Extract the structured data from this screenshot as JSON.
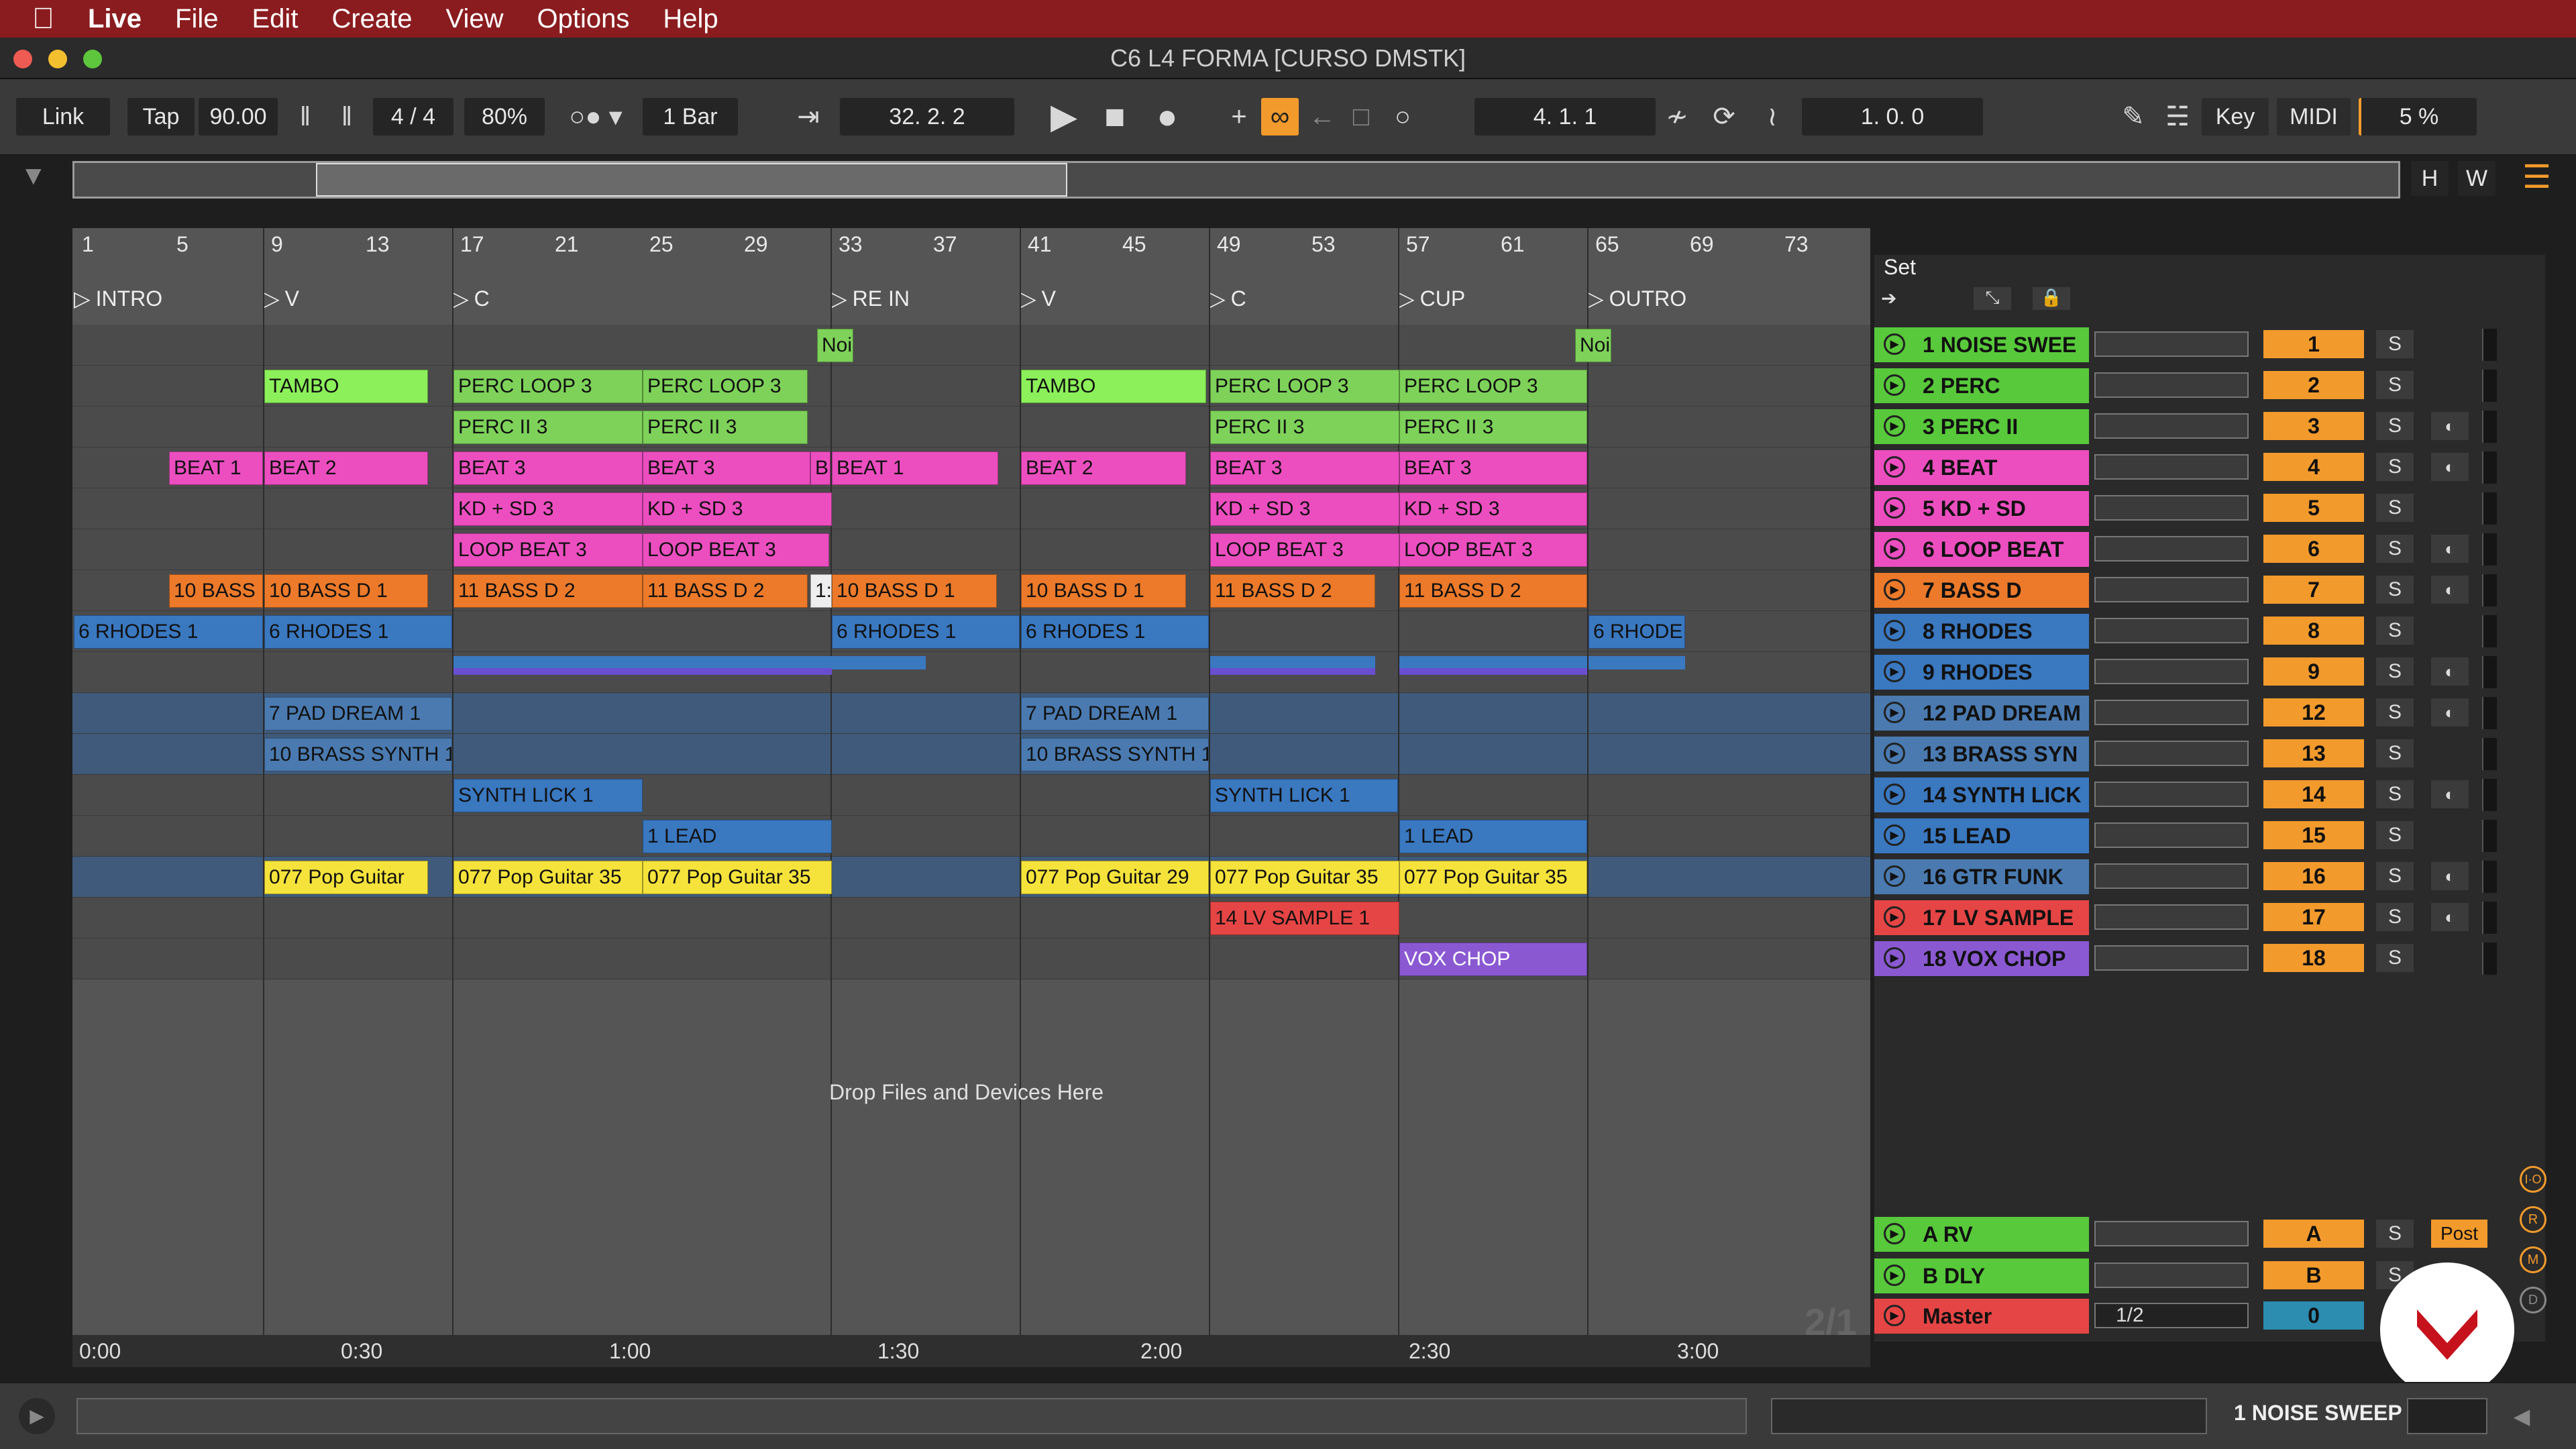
{
  "menubar": {
    "apple": "",
    "items": [
      "Live",
      "File",
      "Edit",
      "Create",
      "View",
      "Options",
      "Help"
    ]
  },
  "window": {
    "title": "C6 L4 FORMA  [CURSO DMSTK]"
  },
  "control": {
    "link": "Link",
    "tap": "Tap",
    "tempo": "90.00",
    "signature": "4 / 4",
    "zoom": "80%",
    "quantize": "1 Bar",
    "position": "32.   2.   2",
    "loop_start": "4.   1.   1",
    "loop_length": "1.   0.   0",
    "key": "Key",
    "midi": "MIDI",
    "cpu": "5 %"
  },
  "ruler": {
    "bars": [
      "1",
      "5",
      "9",
      "13",
      "17",
      "21",
      "25",
      "29",
      "33",
      "37",
      "41",
      "45",
      "49",
      "53",
      "57",
      "61",
      "65",
      "69",
      "73"
    ]
  },
  "locators": [
    {
      "name": "INTRO"
    },
    {
      "name": "V"
    },
    {
      "name": "C"
    },
    {
      "name": "RE IN"
    },
    {
      "name": "V"
    },
    {
      "name": "C"
    },
    {
      "name": "CUP"
    },
    {
      "name": "OUTRO"
    }
  ],
  "clips": {
    "noise1": "Noi",
    "noise2": "Noi",
    "tambo1": "TAMBO",
    "tambo2": "TAMBO",
    "perc_a": "PERC LOOP 3",
    "perc_b": "PERC LOOP 3",
    "perc_c": "PERC LOOP 3",
    "perc_d": "PERC LOOP 3",
    "percii_a": "PERC II 3",
    "percii_b": "PERC II 3",
    "percii_c": "PERC II 3",
    "percii_d": "PERC II 3",
    "beat1a": "BEAT 1",
    "beat2a": "BEAT 2",
    "beat3a": "BEAT 3",
    "beat3b": "BEAT 3",
    "beatB": "B",
    "beat1b": "BEAT 1",
    "beat2b": "BEAT 2",
    "beat3c": "BEAT 3",
    "beat3d": "BEAT 3",
    "kd_a": "KD + SD 3",
    "kd_b": "KD + SD 3",
    "kd_c": "KD + SD 3",
    "kd_d": "KD + SD 3",
    "lb_a": "LOOP BEAT 3",
    "lb_b": "LOOP BEAT 3",
    "lb_c": "LOOP BEAT 3",
    "lb_d": "LOOP BEAT 3",
    "bass_a": "10 BASS",
    "bass_b": "10 BASS D 1",
    "bass_c": "11 BASS D 2",
    "bass_d": "11 BASS D 2",
    "bass_e": "1:",
    "bass_f": "10 BASS D 1",
    "bass_g": "10 BASS D 1",
    "bass_h": "11 BASS D 2",
    "bass_i": "11 BASS D 2",
    "rh_a": "6 RHODES 1",
    "rh_b": "6 RHODES 1",
    "rh_c": "6 RHODES 1",
    "rh_d": "6 RHODES 1",
    "rh_e": "6 RHODE",
    "pad_a": "7 PAD DREAM 1",
    "pad_b": "7 PAD DREAM 1",
    "brass_a": "10 BRASS SYNTH 1",
    "brass_b": "10 BRASS SYNTH 1",
    "lick_a": "SYNTH LICK 1",
    "lick_b": "SYNTH LICK 1",
    "lead_a": "1 LEAD",
    "lead_b": "1 LEAD",
    "gtr_a": "077 Pop Guitar",
    "gtr_b": "077 Pop Guitar 35",
    "gtr_c": "077 Pop Guitar 35",
    "gtr_d": "077 Pop Guitar 29",
    "gtr_e": "077 Pop Guitar 35",
    "gtr_f": "077 Pop Guitar 35",
    "lv": "14 LV SAMPLE 1",
    "vox": "VOX CHOP"
  },
  "drop_hint": "Drop Files and Devices Here",
  "set_label": "Set",
  "tracks": [
    {
      "name": "1 NOISE SWEE",
      "num": "1",
      "color": "#58c93b"
    },
    {
      "name": "2 PERC",
      "num": "2",
      "color": "#58c93b"
    },
    {
      "name": "3 PERC II",
      "num": "3",
      "color": "#58c93b"
    },
    {
      "name": "4 BEAT",
      "num": "4",
      "color": "#ec4ec0"
    },
    {
      "name": "5 KD + SD",
      "num": "5",
      "color": "#ec4ec0"
    },
    {
      "name": "6 LOOP BEAT",
      "num": "6",
      "color": "#ec4ec0"
    },
    {
      "name": "7 BASS D",
      "num": "7",
      "color": "#ec7a2a"
    },
    {
      "name": "8 RHODES",
      "num": "8",
      "color": "#3a78c0"
    },
    {
      "name": "9 RHODES",
      "num": "9",
      "color": "#3a78c0"
    },
    {
      "name": "12 PAD DREAM",
      "num": "12",
      "color": "#4a7ab0"
    },
    {
      "name": "13 BRASS SYN",
      "num": "13",
      "color": "#4a7ab0"
    },
    {
      "name": "14 SYNTH LICK",
      "num": "14",
      "color": "#3a78c0"
    },
    {
      "name": "15 LEAD",
      "num": "15",
      "color": "#3a78c0"
    },
    {
      "name": "16 GTR FUNK",
      "num": "16",
      "color": "#4a7ab0"
    },
    {
      "name": "17 LV SAMPLE",
      "num": "17",
      "color": "#e64545"
    },
    {
      "name": "18 VOX CHOP",
      "num": "18",
      "color": "#8a59d2"
    }
  ],
  "returns": [
    {
      "name": "A RV",
      "num": "A",
      "color": "#58c93b"
    },
    {
      "name": "B DLY",
      "num": "B",
      "color": "#58c93b"
    }
  ],
  "master": {
    "name": "Master",
    "quant": "1/2",
    "num": "0",
    "color": "#e64545"
  },
  "post": "Post",
  "page_indicator": "2/1",
  "solo": "S",
  "times": [
    "0:00",
    "0:30",
    "1:00",
    "1:30",
    "2:00",
    "2:30",
    "3:00"
  ],
  "status": {
    "selected_track": "1 NOISE SWEEP"
  },
  "overview_buttons": {
    "h": "H",
    "w": "W"
  }
}
